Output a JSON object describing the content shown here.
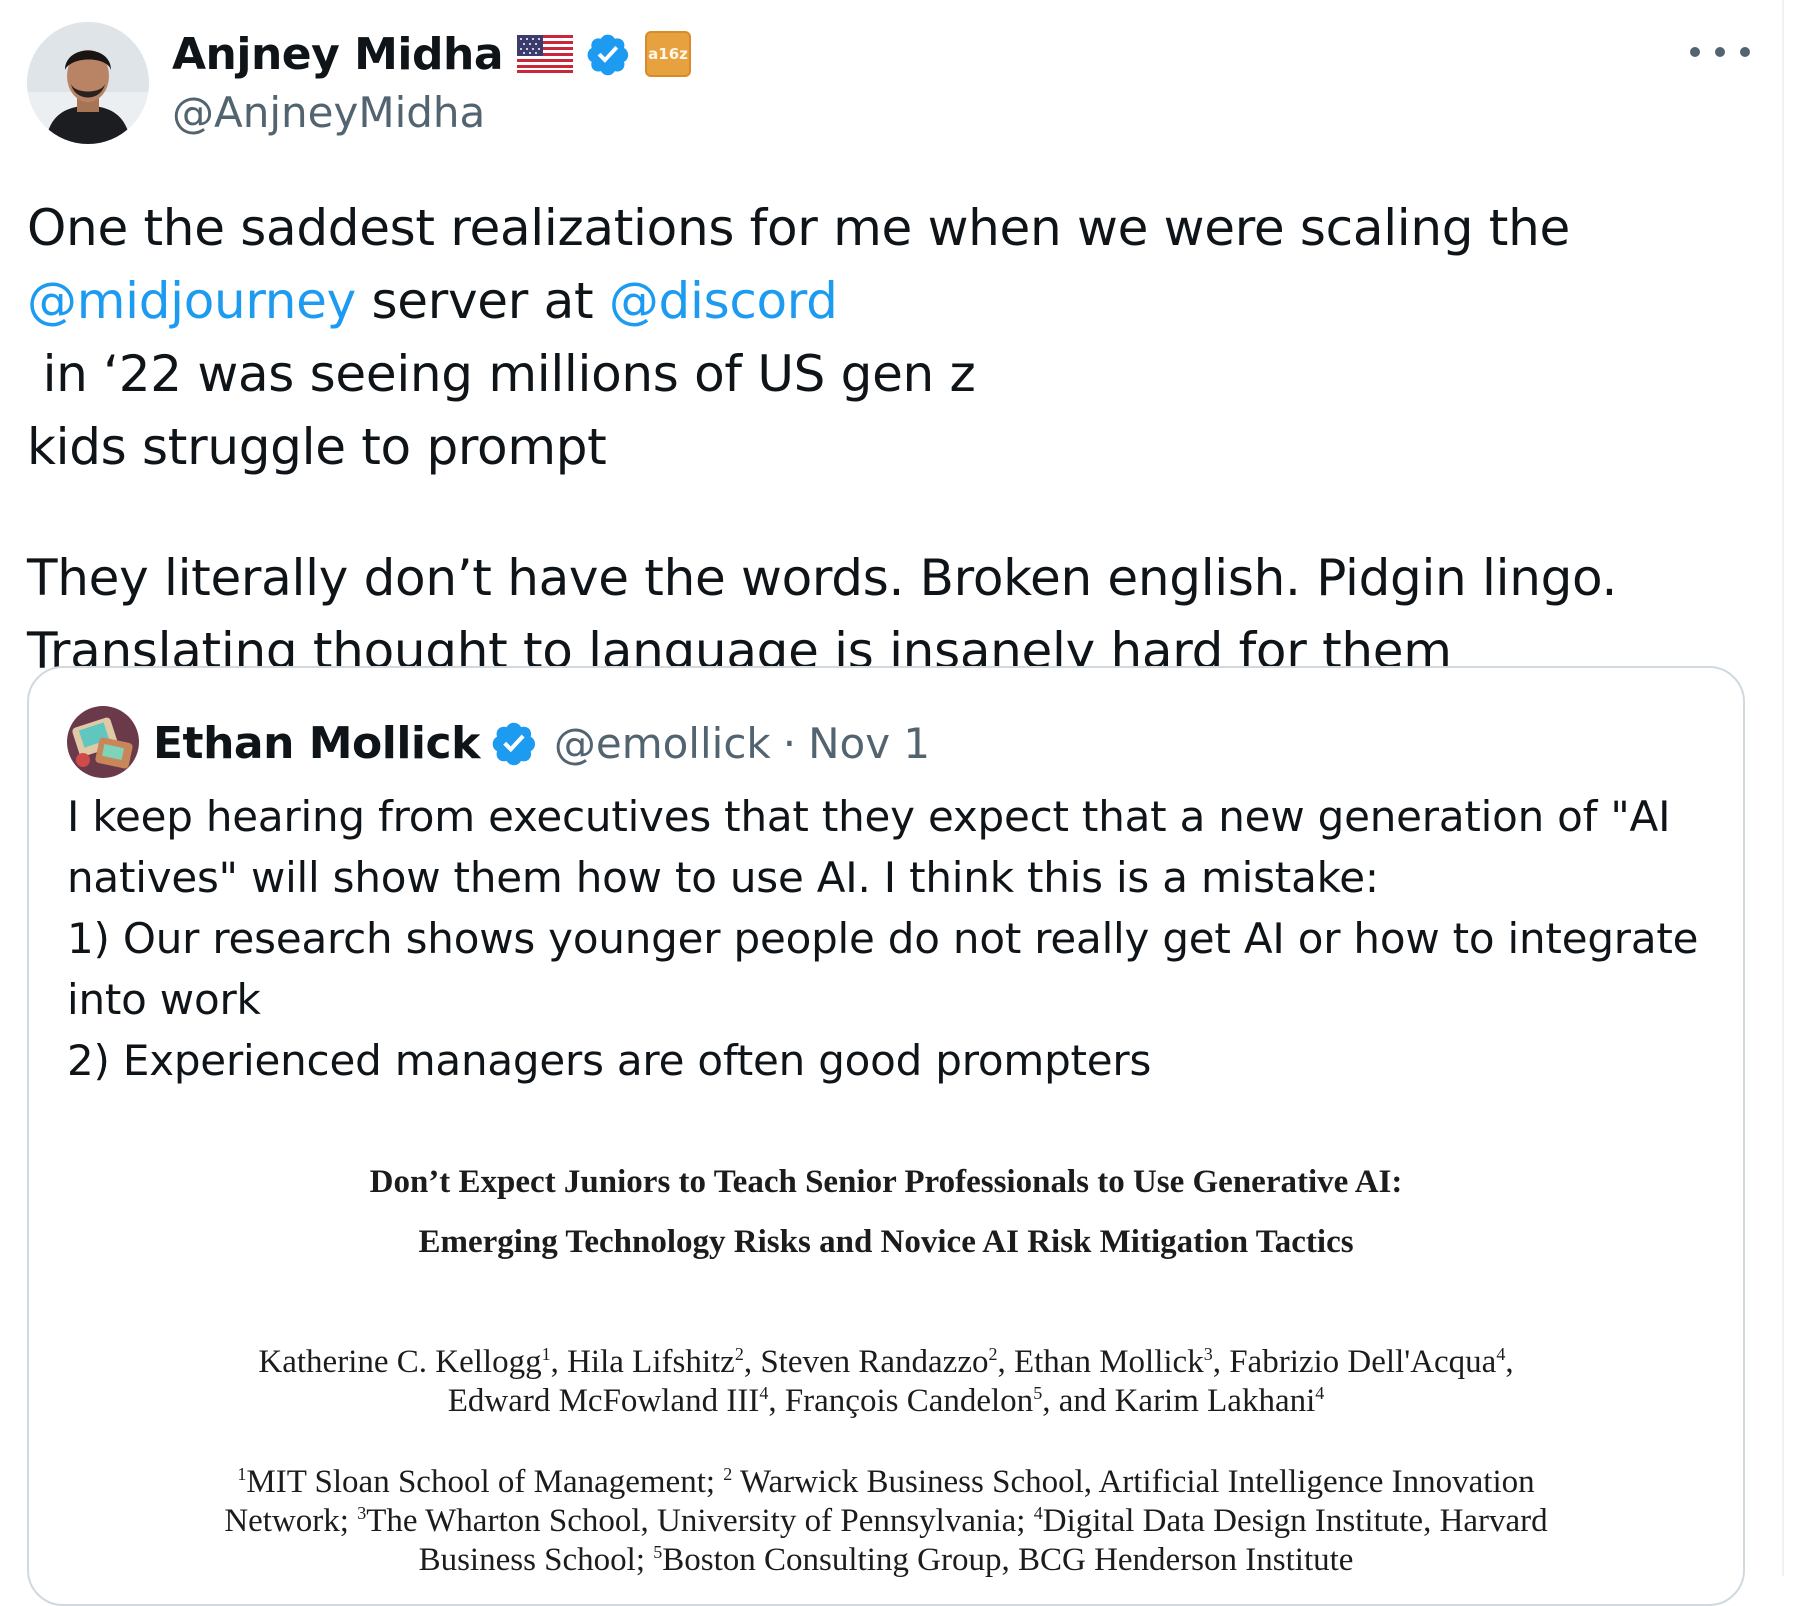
{
  "tweet": {
    "author": {
      "name": "Anjney Midha",
      "handle": "@AnjneyMidha",
      "badges": [
        "us-flag-icon",
        "verified-badge-icon",
        "a16z-affiliate-icon"
      ],
      "affiliate_label": "a16z"
    },
    "text": {
      "p1_a": "One the saddest realizations for me when we were scaling the",
      "mention_1": "@midjourney",
      "p1_b": " server at ",
      "mention_2": "@discord",
      "p1_c": " in ‘22 was seeing millions of US gen z",
      "p1_d": "kids struggle to prompt",
      "p2_a": "They literally don’t have the words. Broken english. Pidgin lingo.",
      "p2_b": "Translating thought to language is insanely hard for them"
    },
    "colors": {
      "link": "#1d9bf0",
      "secondary": "#536471",
      "verified": "#1d9bf0",
      "border": "#cfd9de"
    }
  },
  "quote": {
    "author": {
      "name": "Ethan Mollick",
      "handle": "@emollick",
      "separator": "·",
      "date": "Nov 1"
    },
    "lines": [
      "I keep hearing from executives that they expect that a new generation of \"AI",
      "natives\" will show them how to use AI. I think this is a mistake:",
      "1) Our research shows younger people do not really get AI or how to integrate",
      "into work",
      "2) Experienced managers are often good prompters"
    ],
    "paper": {
      "title_line1": "Don’t Expect Juniors to Teach Senior Professionals to Use Generative AI:",
      "title_line2": "Emerging Technology Risks and Novice AI Risk Mitigation Tactics",
      "authors": {
        "a1": "Katherine C. Kellogg",
        "a1_sup": "1",
        "a2": ", Hila Lifshitz",
        "a2_sup": "2",
        "a3": ", Steven Randazzo",
        "a3_sup": "2",
        "a4": ", Ethan Mollick",
        "a4_sup": "3",
        "a5": ", Fabrizio Dell'Acqua",
        "a5_sup": "4",
        "a5_end": ",",
        "a6": "Edward McFowland III",
        "a6_sup": "4",
        "a7": ", François Candelon",
        "a7_sup": "5",
        "a8": ", and Karim Lakhani",
        "a8_sup": "4"
      },
      "affiliations": {
        "s1": "1",
        "t1": "MIT Sloan School of Management; ",
        "s2": "2",
        "t2": " Warwick Business School, Artificial Intelligence Innovation",
        "t2b": "Network; ",
        "s3": "3",
        "t3": "The Wharton School, University of Pennsylvania; ",
        "s4": "4",
        "t4": "Digital Data Design Institute, Harvard",
        "t4b": "Business School; ",
        "s5": "5",
        "t5": "Boston Consulting Group, BCG Henderson Institute"
      }
    }
  }
}
